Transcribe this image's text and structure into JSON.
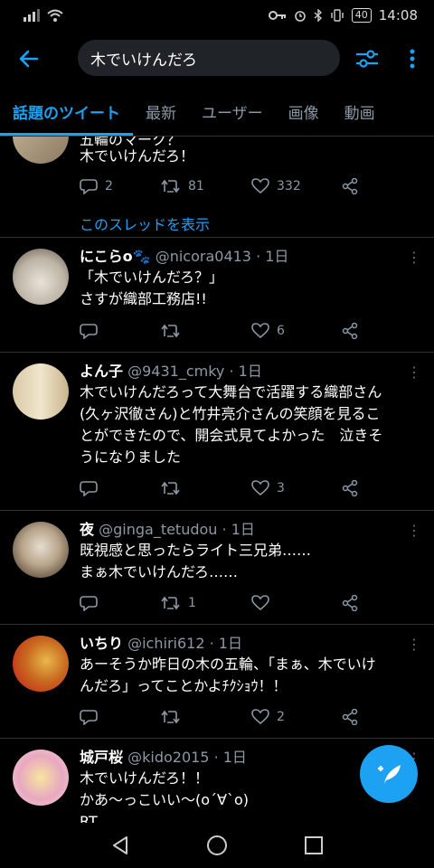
{
  "status": {
    "time": "14:08",
    "battery": "40"
  },
  "search": {
    "query": "木でいけんだろ"
  },
  "tabs": [
    {
      "label": "話題のツイート"
    },
    {
      "label": "最新"
    },
    {
      "label": "ユーザー"
    },
    {
      "label": "画像"
    },
    {
      "label": "動画"
    }
  ],
  "tweets": [
    {
      "text_partial": "五輪のマーク？",
      "text": "木でいけんだろ！",
      "replies": "2",
      "retweets": "81",
      "likes": "332",
      "thread_link": "このスレッドを表示"
    },
    {
      "name": "にこらo🐾",
      "handle": "@nicora0413",
      "time": "1日",
      "text1": "「木でいけんだろ？」",
      "text2": "さすが織部工務店!!",
      "replies": "",
      "retweets": "",
      "likes": "6"
    },
    {
      "name": "よん子",
      "handle": "@9431_cmky",
      "time": "1日",
      "text1": "木でいけんだろって大舞台で活躍する織部さん",
      "text2": "(久ヶ沢徹さん)と竹井亮介さんの笑顔を見るこ",
      "text3": "とができたので、開会式見てよかった　泣きそ",
      "text4": "うになりました",
      "replies": "",
      "retweets": "",
      "likes": "3"
    },
    {
      "name": "夜",
      "handle": "@ginga_tetudou",
      "time": "1日",
      "text1": "既視感と思ったらライト三兄弟……",
      "text2": "まぁ木でいけんだろ……",
      "replies": "",
      "retweets": "1",
      "likes": ""
    },
    {
      "name": "いちり",
      "handle": "@ichiri612",
      "time": "1日",
      "text1": "あーそうか昨日の木の五輪、「まぁ、木でいけ",
      "text2": "んだろ」ってことかよﾁｸｼｮｳ！！",
      "replies": "",
      "retweets": "",
      "likes": "2"
    },
    {
      "name": "城戸桜",
      "handle": "@kido2015",
      "time": "1日",
      "text1": "木でいけんだろ！！",
      "text2": "かあ〜っこいい〜(o´∀`o)",
      "text3": "RT"
    }
  ],
  "icons": {
    "back": "back-arrow-icon",
    "filter": "filter-icon",
    "more": "more-vert-icon",
    "reply": "reply-icon",
    "retweet": "retweet-icon",
    "like": "heart-icon",
    "share": "share-icon",
    "compose": "compose-tweet-icon"
  },
  "colors": {
    "accent": "#1da1f2",
    "background": "#000000",
    "muted": "#8b98a5"
  }
}
